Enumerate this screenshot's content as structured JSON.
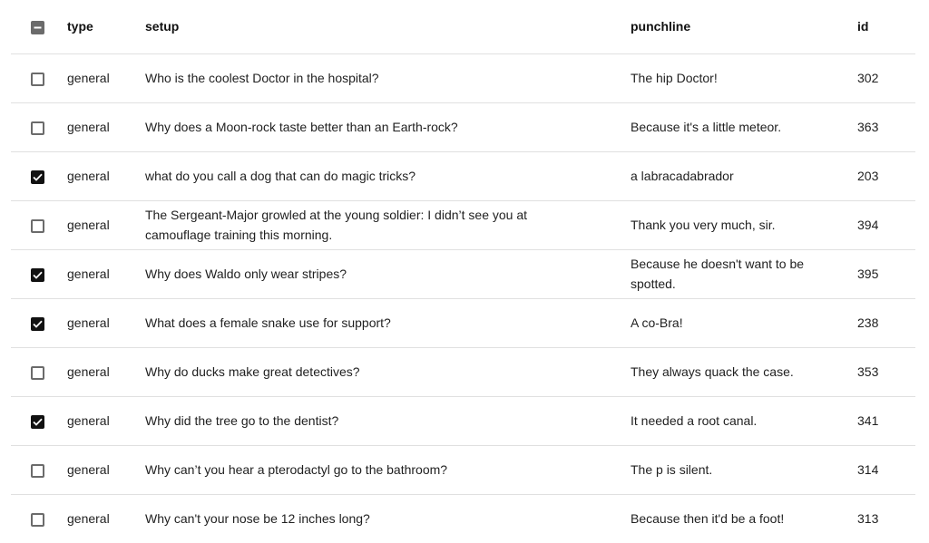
{
  "table": {
    "header": {
      "select_all_state": "indeterminate",
      "columns": [
        "type",
        "setup",
        "punchline",
        "id"
      ]
    },
    "rows": [
      {
        "checked": false,
        "type": "general",
        "setup": "Who is the coolest Doctor in the hospital?",
        "punchline": "The hip Doctor!",
        "id": "302"
      },
      {
        "checked": false,
        "type": "general",
        "setup": "Why does a Moon-rock taste better than an Earth-rock?",
        "punchline": "Because it's a little meteor.",
        "id": "363"
      },
      {
        "checked": true,
        "type": "general",
        "setup": "what do you call a dog that can do magic tricks?",
        "punchline": "a labracadabrador",
        "id": "203"
      },
      {
        "checked": false,
        "type": "general",
        "setup": "The Sergeant-Major growled at the young soldier: I didn’t see you at camouflage training this morning.",
        "punchline": "Thank you very much, sir.",
        "id": "394"
      },
      {
        "checked": true,
        "type": "general",
        "setup": "Why does Waldo only wear stripes?",
        "punchline": "Because he doesn't want to be spotted.",
        "id": "395"
      },
      {
        "checked": true,
        "type": "general",
        "setup": "What does a female snake use for support?",
        "punchline": "A co-Bra!",
        "id": "238"
      },
      {
        "checked": false,
        "type": "general",
        "setup": "Why do ducks make great detectives?",
        "punchline": "They always quack the case.",
        "id": "353"
      },
      {
        "checked": true,
        "type": "general",
        "setup": "Why did the tree go to the dentist?",
        "punchline": "It needed a root canal.",
        "id": "341"
      },
      {
        "checked": false,
        "type": "general",
        "setup": "Why can’t you hear a pterodactyl go to the bathroom?",
        "punchline": "The p is silent.",
        "id": "314"
      },
      {
        "checked": false,
        "type": "general",
        "setup": "Why can't your nose be 12 inches long?",
        "punchline": "Because then it'd be a foot!",
        "id": "313"
      }
    ]
  },
  "icons": {
    "checked": "check-icon",
    "indeterminate": "minus-icon"
  }
}
